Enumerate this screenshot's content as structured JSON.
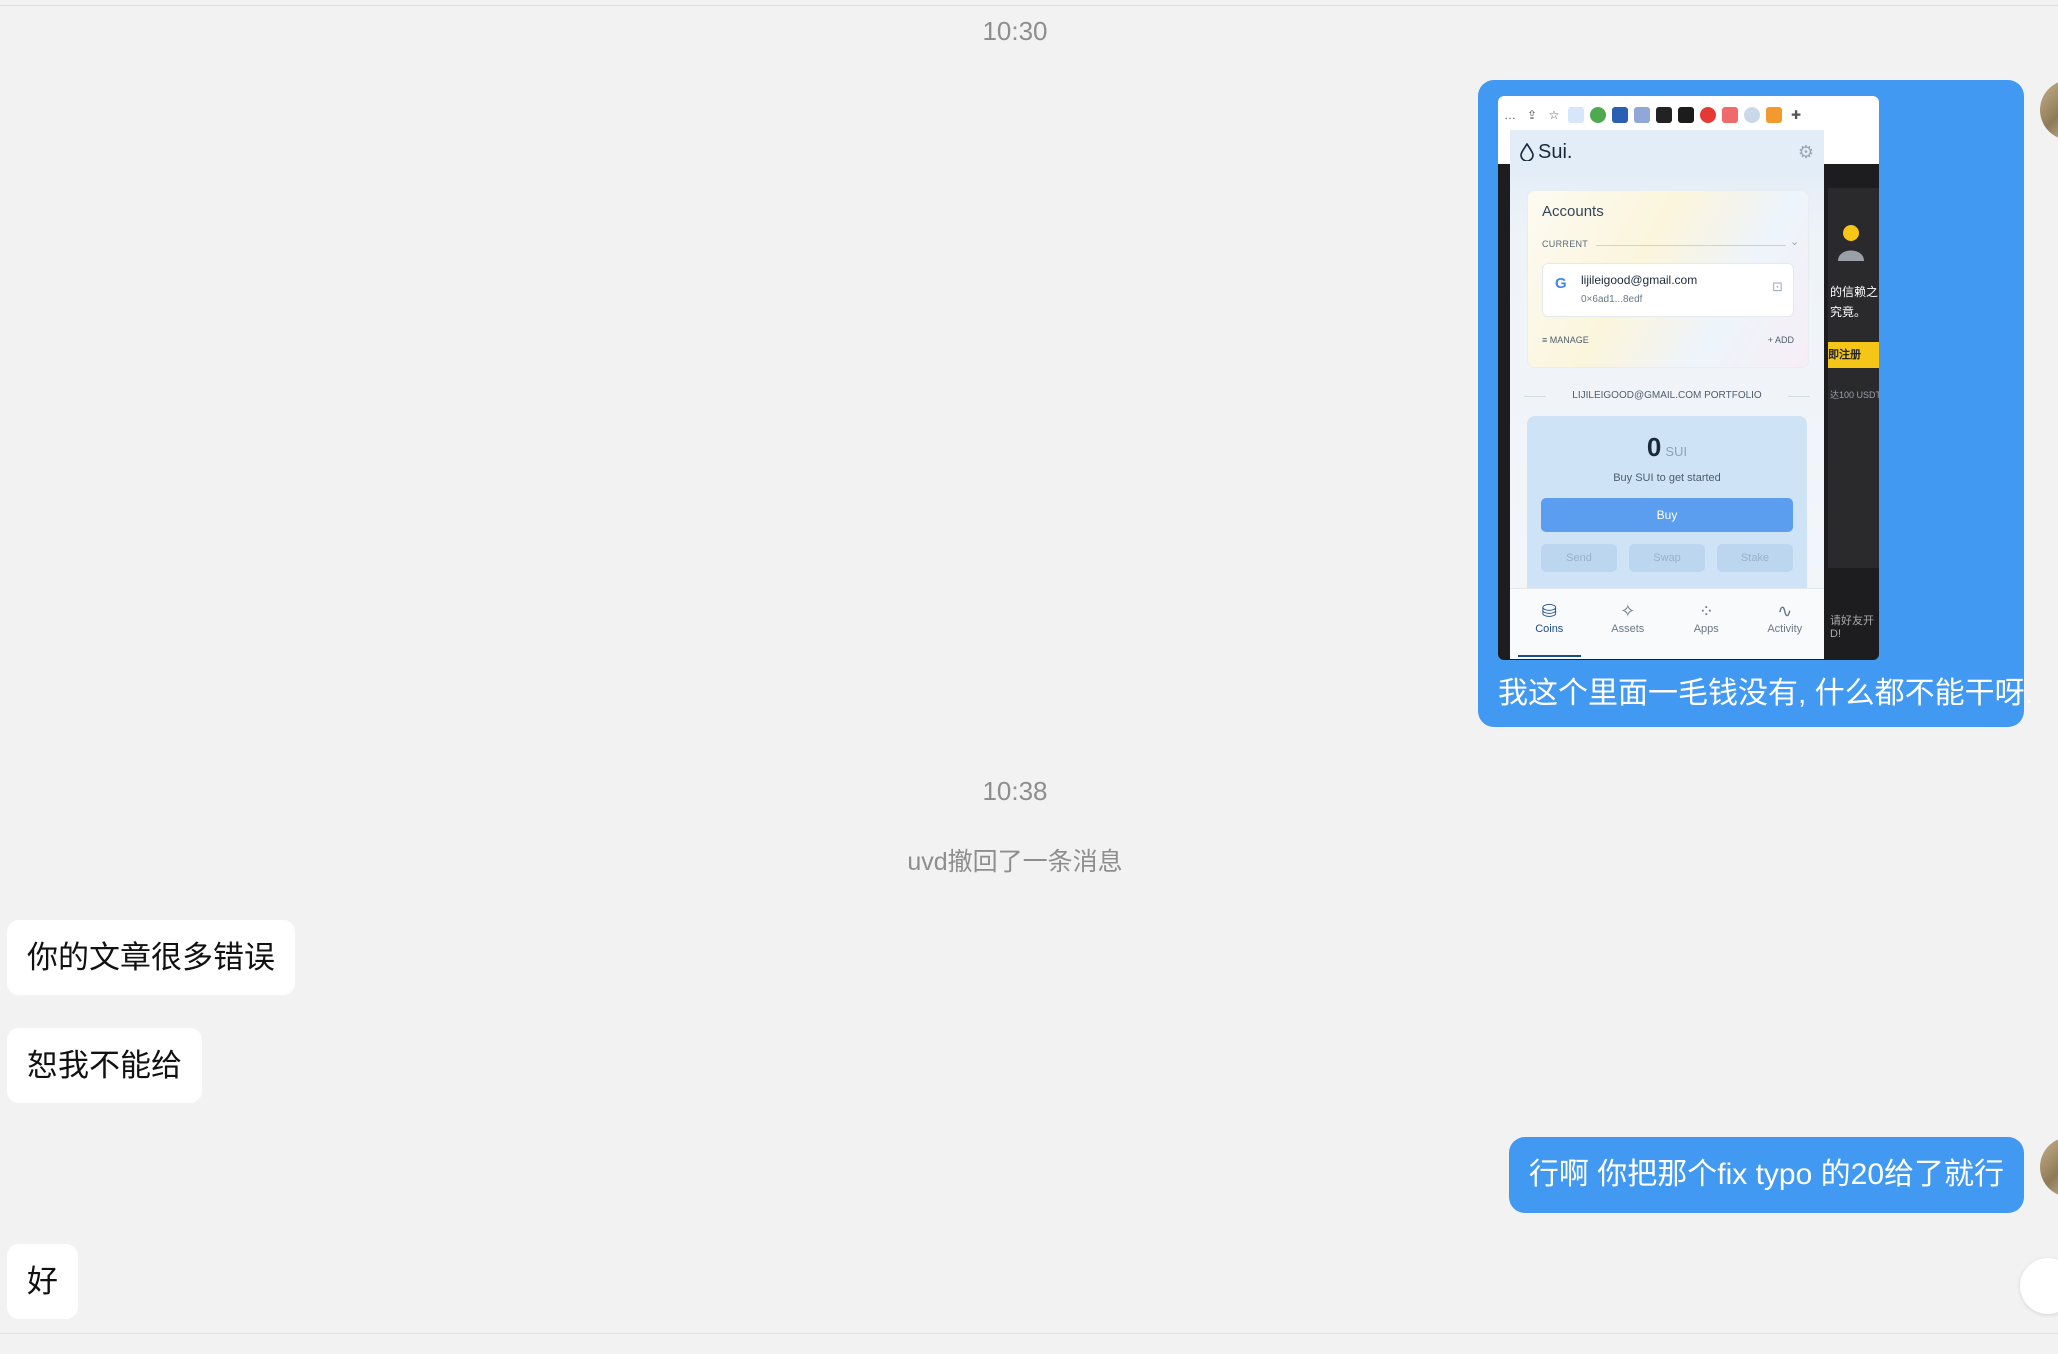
{
  "timestamps": {
    "first": "10:30",
    "second": "10:38"
  },
  "system_message": "uvd撤回了一条消息",
  "outgoing_image_message": {
    "caption": "我这个里面一毛钱没有, 什么都不能干呀.",
    "screenshot": {
      "browser_bg_text": [
        "的信赖之",
        "究竟。",
        "即注册",
        "达100 USDT",
        "请好友开",
        "D!"
      ],
      "wallet": {
        "logo": "Sui.",
        "accounts_title": "Accounts",
        "current_label": "CURRENT",
        "account_email": "lijileigood@gmail.com",
        "account_address": "0×6ad1...8edf",
        "manage_label": "MANAGE",
        "add_label": "ADD",
        "portfolio_label": "LIJILEIGOOD@GMAIL.COM PORTFOLIO",
        "balance": "0",
        "balance_unit": "SUI",
        "balance_hint": "Buy SUI to get started",
        "buy_label": "Buy",
        "send_label": "Send",
        "swap_label": "Swap",
        "stake_label": "Stake",
        "nav": [
          {
            "label": "Coins",
            "icon": "coins-icon",
            "active": true
          },
          {
            "label": "Assets",
            "icon": "sparkle-icon",
            "active": false
          },
          {
            "label": "Apps",
            "icon": "apps-grid-icon",
            "active": false
          },
          {
            "label": "Activity",
            "icon": "activity-icon",
            "active": false
          }
        ]
      }
    }
  },
  "incoming_messages": [
    "你的文章很多错误",
    "恕我不能给",
    "好"
  ],
  "outgoing_text_message": "行啊   你把那个fix typo 的20给了就行",
  "colors": {
    "outgoing_bubble": "#4299f2",
    "incoming_bubble": "#ffffff",
    "background": "#f2f2f2"
  }
}
